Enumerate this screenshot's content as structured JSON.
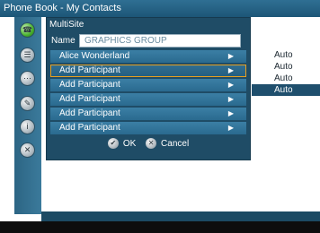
{
  "window": {
    "title": "Phone Book - My Contacts"
  },
  "sidebar": {
    "icons": [
      {
        "name": "call-icon",
        "glyph": "☎",
        "active": true
      },
      {
        "name": "directory-icon",
        "glyph": "☰",
        "active": false
      },
      {
        "name": "keypad-icon",
        "glyph": "⋯",
        "active": false
      },
      {
        "name": "edit-icon",
        "glyph": "✎",
        "active": false
      },
      {
        "name": "info-icon",
        "glyph": "i",
        "active": false
      },
      {
        "name": "close-icon",
        "glyph": "✕",
        "active": false
      }
    ]
  },
  "right_list": {
    "items": [
      "Auto",
      "Auto",
      "Auto",
      "Auto"
    ],
    "selected_index": 3
  },
  "dialog": {
    "title": "MultiSite",
    "name_label": "Name",
    "name_value": "GRAPHICS GROUP",
    "rows": [
      {
        "label": "Alice Wonderland",
        "arrow": "▶"
      },
      {
        "label": "Add Participant",
        "arrow": "▶"
      },
      {
        "label": "Add Participant",
        "arrow": "▶"
      },
      {
        "label": "Add Participant",
        "arrow": "▶"
      },
      {
        "label": "Add Participant",
        "arrow": "▶"
      },
      {
        "label": "Add Participant",
        "arrow": "▶"
      }
    ],
    "focused_row": 1,
    "ok_label": "OK",
    "ok_glyph": "✔",
    "cancel_label": "Cancel",
    "cancel_glyph": "✕"
  },
  "colors": {
    "dialog_bg": "#1f4c66",
    "row_bg": "#2f7399",
    "focus_border": "#e8a020",
    "selected_bg": "#1f4f6d",
    "title_bar": "#2a6688"
  }
}
